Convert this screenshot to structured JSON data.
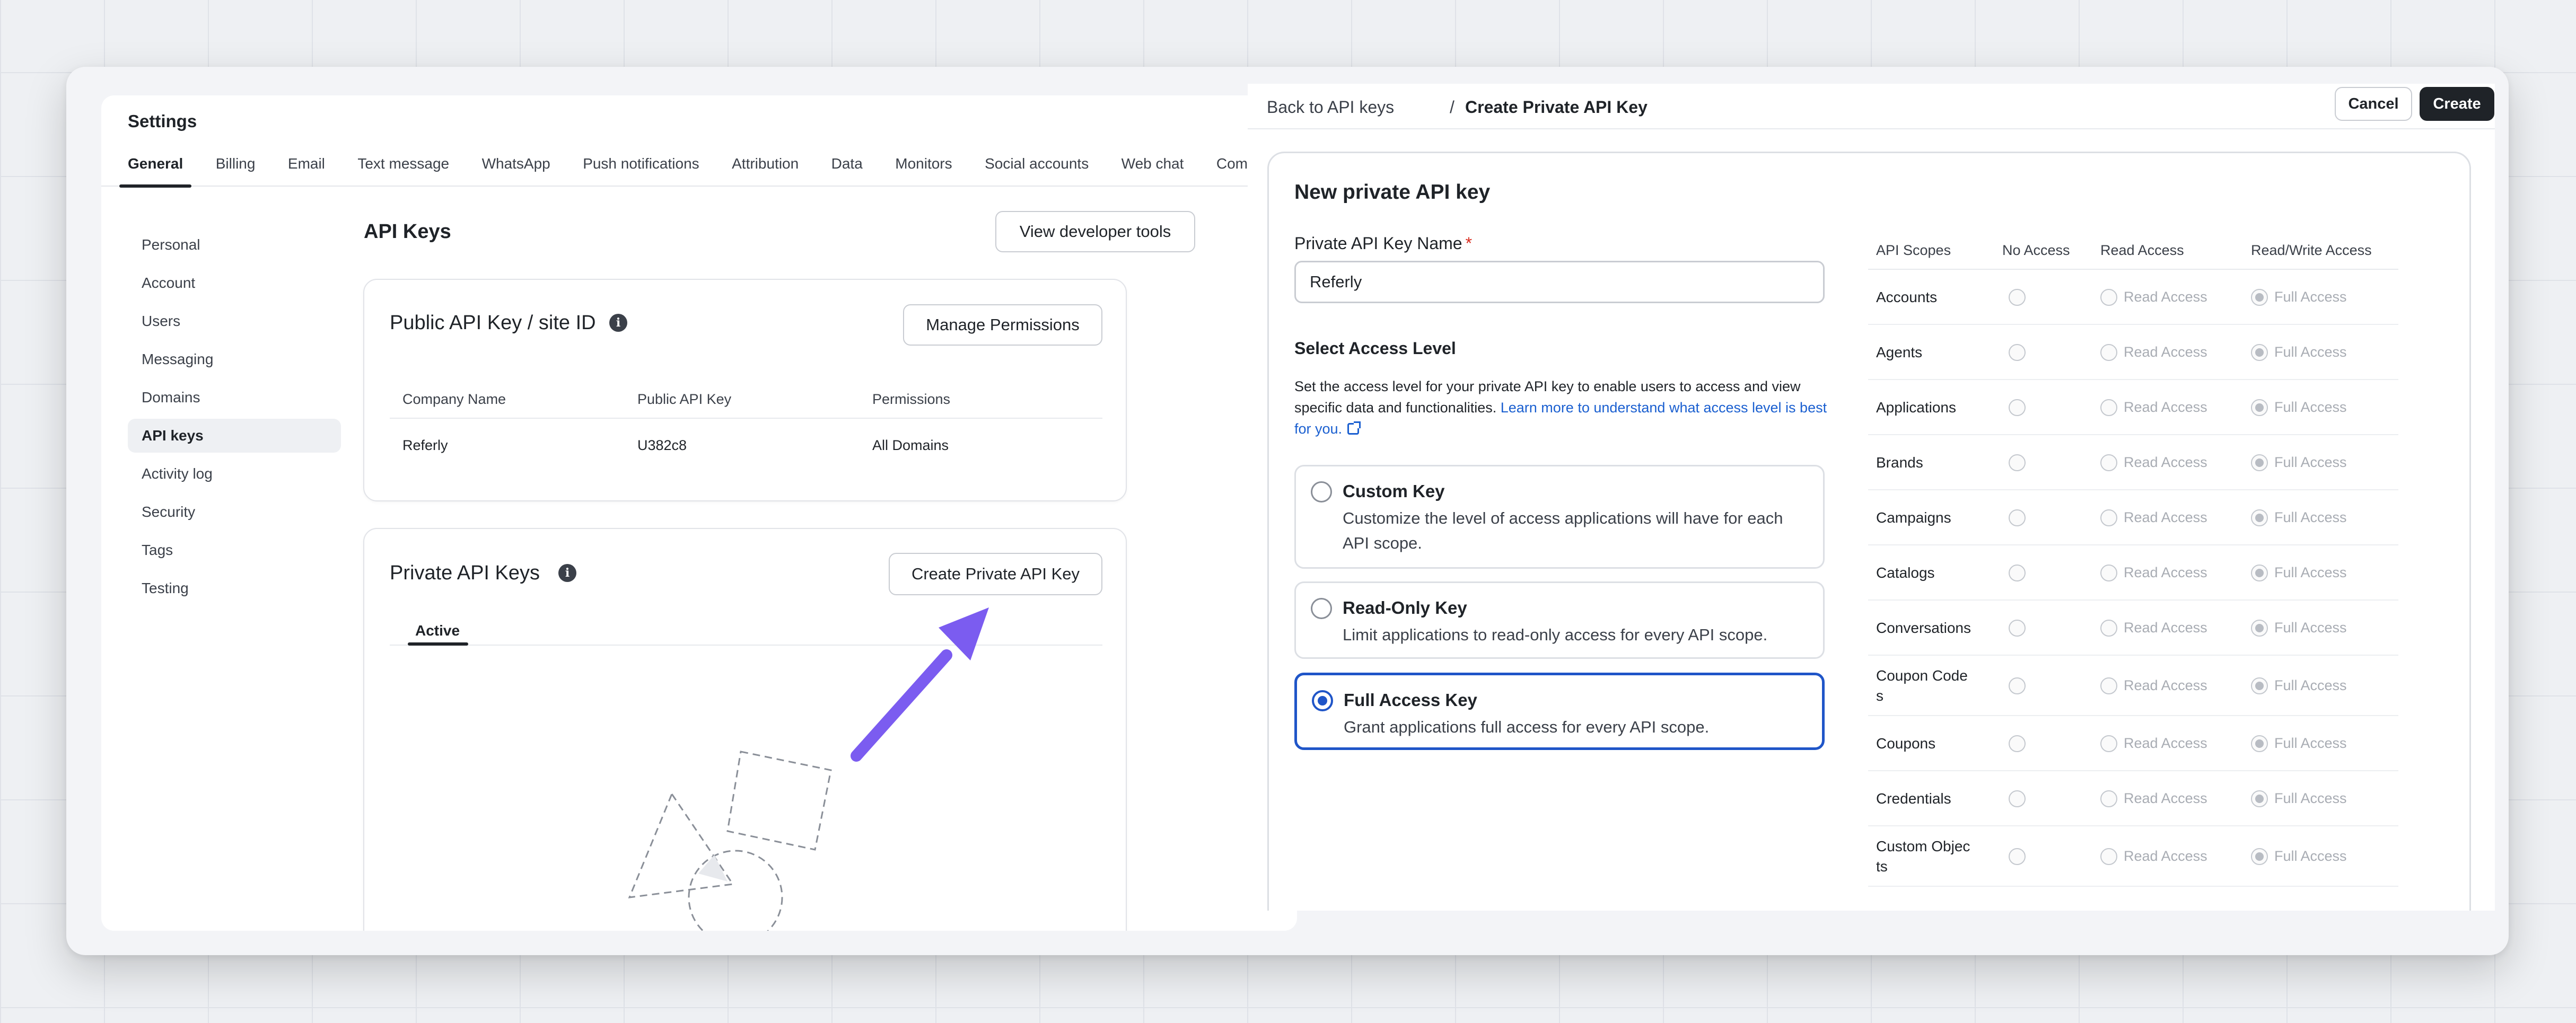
{
  "settings": {
    "title": "Settings",
    "tabs": [
      "General",
      "Billing",
      "Email",
      "Text message",
      "WhatsApp",
      "Push notifications",
      "Attribution",
      "Data",
      "Monitors",
      "Social accounts",
      "Web chat",
      "Com"
    ],
    "nav": [
      "Personal",
      "Account",
      "Users",
      "Messaging",
      "Domains",
      "API keys",
      "Activity log",
      "Security",
      "Tags",
      "Testing"
    ],
    "active_nav": "API keys",
    "page_title": "API Keys",
    "dev_tools_button": "View developer tools",
    "public_card": {
      "title": "Public API Key / site ID",
      "manage_button": "Manage Permissions",
      "headers": [
        "Company Name",
        "Public API Key",
        "Permissions"
      ],
      "row": [
        "Referly",
        "U382c8",
        "All Domains"
      ]
    },
    "private_card": {
      "title": "Private API Keys",
      "create_button": "Create Private API Key",
      "tab_active": "Active"
    }
  },
  "create_panel": {
    "breadcrumb_link": "Back to API keys",
    "breadcrumb_sep": "/",
    "breadcrumb_current": "Create Private API Key",
    "cancel_button": "Cancel",
    "create_button": "Create",
    "form_title": "New private API key",
    "name_label": "Private API Key Name",
    "required_mark": "*",
    "name_value": "Referly",
    "access_title": "Select Access Level",
    "access_desc": "Set the access level for your private API key to enable users to access and view specific data and functionalities.",
    "access_link": "Learn more to understand what access level is best for you.",
    "options": [
      {
        "title": "Custom Key",
        "desc": "Customize the level of access applications will have for each API scope.",
        "selected": false
      },
      {
        "title": "Read-Only Key",
        "desc": "Limit applications to read-only access for every API scope.",
        "selected": false
      },
      {
        "title": "Full Access Key",
        "desc": "Grant applications full access for every API scope.",
        "selected": true
      }
    ],
    "scope_headers": [
      "API Scopes",
      "No Access",
      "Read Access",
      "Read/Write Access"
    ],
    "read_label": "Read Access",
    "full_label": "Full Access",
    "scopes": [
      "Accounts",
      "Agents",
      "Applications",
      "Brands",
      "Campaigns",
      "Catalogs",
      "Conversations",
      "Coupon Codes",
      "Coupons",
      "Credentials",
      "Custom Objects"
    ],
    "scope_display": [
      "Accounts",
      "Agents",
      "Applications",
      "Brands",
      "Campaigns",
      "Catalogs",
      "Conversations",
      "Coupon Code\ns",
      "Coupons",
      "Credentials",
      "Custom Objec\nts"
    ]
  },
  "colors": {
    "accent": "#1f55c8",
    "arrow": "#7b5cf0",
    "link": "#1a5fd0",
    "primary_button": "#1f2328"
  },
  "icons": [
    "info-icon",
    "external-link-icon",
    "arrow-annotation-icon",
    "empty-state-illustration"
  ]
}
